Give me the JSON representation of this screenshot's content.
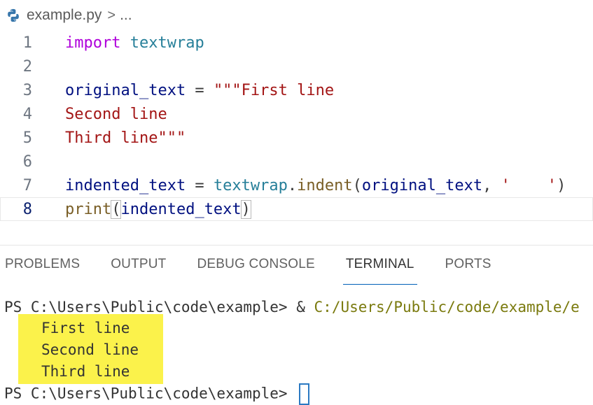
{
  "breadcrumb": {
    "file": "example.py",
    "separator": ">",
    "more": "..."
  },
  "editor": {
    "line_numbers": [
      "1",
      "2",
      "3",
      "4",
      "5",
      "6",
      "7",
      "8"
    ],
    "l1": {
      "kw": "import",
      "mod": "textwrap"
    },
    "l3": {
      "var": "original_text",
      "op": " = ",
      "str": "\"\"\"First line"
    },
    "l4": {
      "str": "Second line"
    },
    "l5": {
      "str": "Third line\"\"\""
    },
    "l7": {
      "var": "indented_text",
      "op": " = ",
      "mod": "textwrap",
      "dot": ".",
      "fn": "indent",
      "open": "(",
      "arg": "original_text",
      "comma": ", ",
      "str": "'    '",
      "close": ")"
    },
    "l8": {
      "fn": "print",
      "open": "(",
      "arg": "indented_text",
      "close": ")"
    }
  },
  "panel": {
    "tabs": [
      "PROBLEMS",
      "OUTPUT",
      "DEBUG CONSOLE",
      "TERMINAL",
      "PORTS"
    ],
    "active_tab": "TERMINAL"
  },
  "terminal": {
    "prompt": "PS C:\\Users\\Public\\code\\example> ",
    "command_amp": "& ",
    "command_path": "C:/Users/Public/code/example/e",
    "output": [
      "First line",
      "Second line",
      "Third line"
    ],
    "prompt2": "PS C:\\Users\\Public\\code\\example> "
  },
  "colors": {
    "highlight": "#fbf24b",
    "tab_underline": "#005fb8",
    "keyword": "#af00db",
    "string": "#a31515"
  }
}
